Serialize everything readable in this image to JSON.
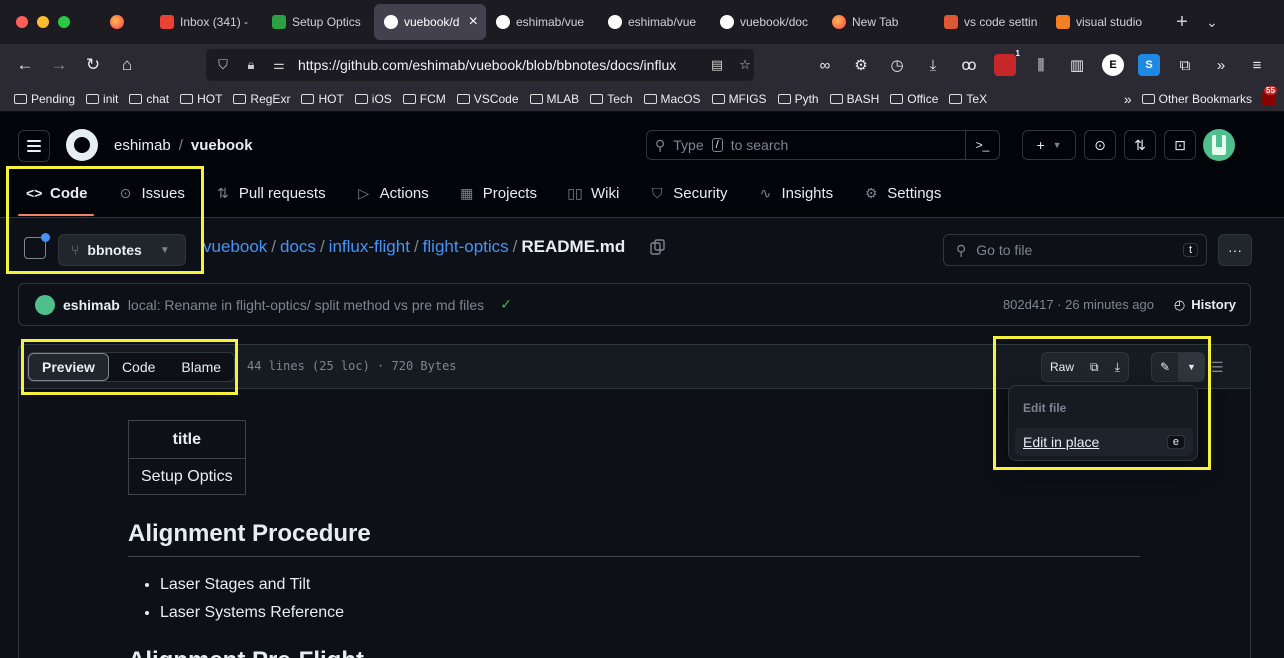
{
  "browser": {
    "tabs": [
      {
        "title": "",
        "favicon": "firefox-icon",
        "color": "#ff7139"
      },
      {
        "title": "Inbox (341) -",
        "favicon": "gmail-icon",
        "color": "#ea4335"
      },
      {
        "title": "Setup Optics",
        "favicon": "w-icon",
        "color": "#2ea043"
      },
      {
        "title": "vuebook/d",
        "favicon": "github-icon",
        "color": "#ffffff",
        "active": true
      },
      {
        "title": "eshimab/vue",
        "favicon": "github-icon",
        "color": "#ffffff"
      },
      {
        "title": "eshimab/vue",
        "favicon": "github-icon",
        "color": "#ffffff"
      },
      {
        "title": "vuebook/doc",
        "favicon": "github-icon",
        "color": "#ffffff"
      },
      {
        "title": "New Tab",
        "favicon": "firefox-icon",
        "color": "#ff7139"
      },
      {
        "title": "vs code settin",
        "favicon": "duckduckgo-icon",
        "color": "#de5833"
      },
      {
        "title": "visual studio",
        "favicon": "stackoverflow-icon",
        "color": "#f48024"
      }
    ],
    "url": "https://github.com/eshimab/vuebook/blob/bbnotes/docs/influx-flight/flight-optics/README.md",
    "url_display_host": "https://github.com/eshimab/vuebook/blob/bbnotes/docs/influx",
    "bookmarks": [
      "Pending",
      "init",
      "chat",
      "HOT",
      "RegExr",
      "HOT",
      "iOS",
      "FCM",
      "VSCode",
      "MLAB",
      "Tech",
      "MacOS",
      "MFIGS",
      "Pyth",
      "BASH",
      "Office",
      "TeX"
    ],
    "other_bookmarks": "Other Bookmarks",
    "badge_count": "55",
    "ext_badge": "1"
  },
  "github": {
    "owner": "eshimab",
    "repo": "vuebook",
    "search_placeholder_prefix": "Type",
    "search_key": "/",
    "search_placeholder_suffix": "to search",
    "plus_label": "+",
    "nav": [
      {
        "label": "Code",
        "icon": "code-icon"
      },
      {
        "label": "Issues",
        "icon": "issue-icon"
      },
      {
        "label": "Pull requests",
        "icon": "pull-request-icon"
      },
      {
        "label": "Actions",
        "icon": "play-icon"
      },
      {
        "label": "Projects",
        "icon": "table-icon"
      },
      {
        "label": "Wiki",
        "icon": "book-icon"
      },
      {
        "label": "Security",
        "icon": "shield-icon"
      },
      {
        "label": "Insights",
        "icon": "graph-icon"
      },
      {
        "label": "Settings",
        "icon": "gear-icon"
      }
    ],
    "branch": "bbnotes",
    "breadcrumb": [
      "vuebook",
      "docs",
      "influx-flight",
      "flight-optics"
    ],
    "filename": "README.md",
    "goto_placeholder": "Go to file",
    "goto_key": "t",
    "commit": {
      "author": "eshimab",
      "message": "local: Rename in flight-optics/ split method vs pre md files",
      "meta": "802d417 · 26 minutes ago",
      "history": "History"
    },
    "file": {
      "tabs": [
        "Preview",
        "Code",
        "Blame"
      ],
      "info": "44 lines (25 loc) · 720 Bytes",
      "raw": "Raw"
    },
    "dropdown": {
      "title": "Edit file",
      "item": "Edit in place",
      "key": "e"
    },
    "markdown": {
      "table_header": "title",
      "table_cell": "Setup Optics",
      "heading1": "Alignment Procedure",
      "bullets": [
        "Laser Stages and Tilt",
        "Laser Systems Reference"
      ],
      "heading2": "Alignment Pre-Flight"
    }
  },
  "colors": {
    "highlight": "#f6f13a",
    "link": "#4493f8",
    "accent_underline": "#f78166",
    "success": "#3fb950"
  }
}
